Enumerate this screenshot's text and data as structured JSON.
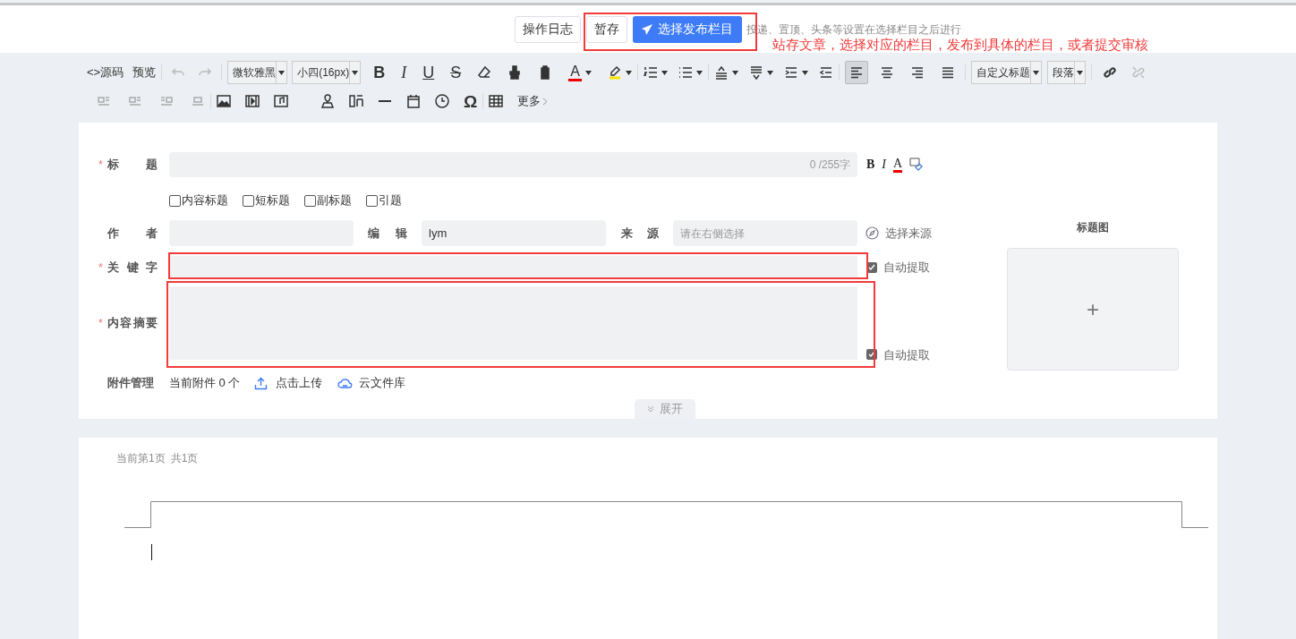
{
  "top_bar": {
    "buttons": [
      {
        "label": "操作日志",
        "kind": "default"
      },
      {
        "label": "暂存",
        "kind": "default"
      },
      {
        "label": "选择发布栏目",
        "kind": "primary"
      }
    ],
    "hint": "投递、置顶、头条等设置在选择栏目之后进行"
  },
  "annotation": {
    "note": "站存文章，选择对应的栏目，发布到具体的栏目，或者提交审核"
  },
  "toolbar": {
    "source": "<>源码",
    "preview": "预览",
    "font": "微软雅黑",
    "size": "小四(16px)",
    "letters": [
      "B",
      "I",
      "U",
      "S"
    ],
    "font_color": "A",
    "alignments": [
      {
        "selected": true
      },
      {
        "selected": false
      },
      {
        "selected": false
      },
      {
        "selected": false
      }
    ],
    "heading": "自定义标题",
    "paragraph": "段落",
    "special_char": "Ω",
    "more": "更多"
  },
  "form": {
    "title": {
      "label": "标题",
      "mark": "*",
      "counter": "0 /255字",
      "format": [
        "B",
        "I",
        "A"
      ]
    },
    "title_options": [
      {
        "label": "内容标题",
        "checked": false
      },
      {
        "label": "短标题",
        "checked": false
      },
      {
        "label": "副标题",
        "checked": false
      },
      {
        "label": "引题",
        "checked": false
      }
    ],
    "author": {
      "label": "作者"
    },
    "editor": {
      "label": "编辑",
      "value": "lym"
    },
    "source": {
      "label": "来源",
      "placeholder": "请在右侧选择",
      "action": "选择来源"
    },
    "keywords": {
      "label": "关键字",
      "mark": "*",
      "auto": {
        "label": "自动提取",
        "checked": true
      }
    },
    "summary": {
      "label": "内容摘要",
      "mark": "*",
      "auto": {
        "label": "自动提取",
        "checked": true
      }
    },
    "attachments": {
      "label": "附件管理",
      "count": "当前附件 0 个",
      "upload": "点击上传",
      "cloud": "云文件库"
    },
    "expand": "展开"
  },
  "title_image": {
    "label": "标题图",
    "add": "+"
  },
  "editor_page": {
    "current": "当前第1页",
    "total": "共1页"
  }
}
